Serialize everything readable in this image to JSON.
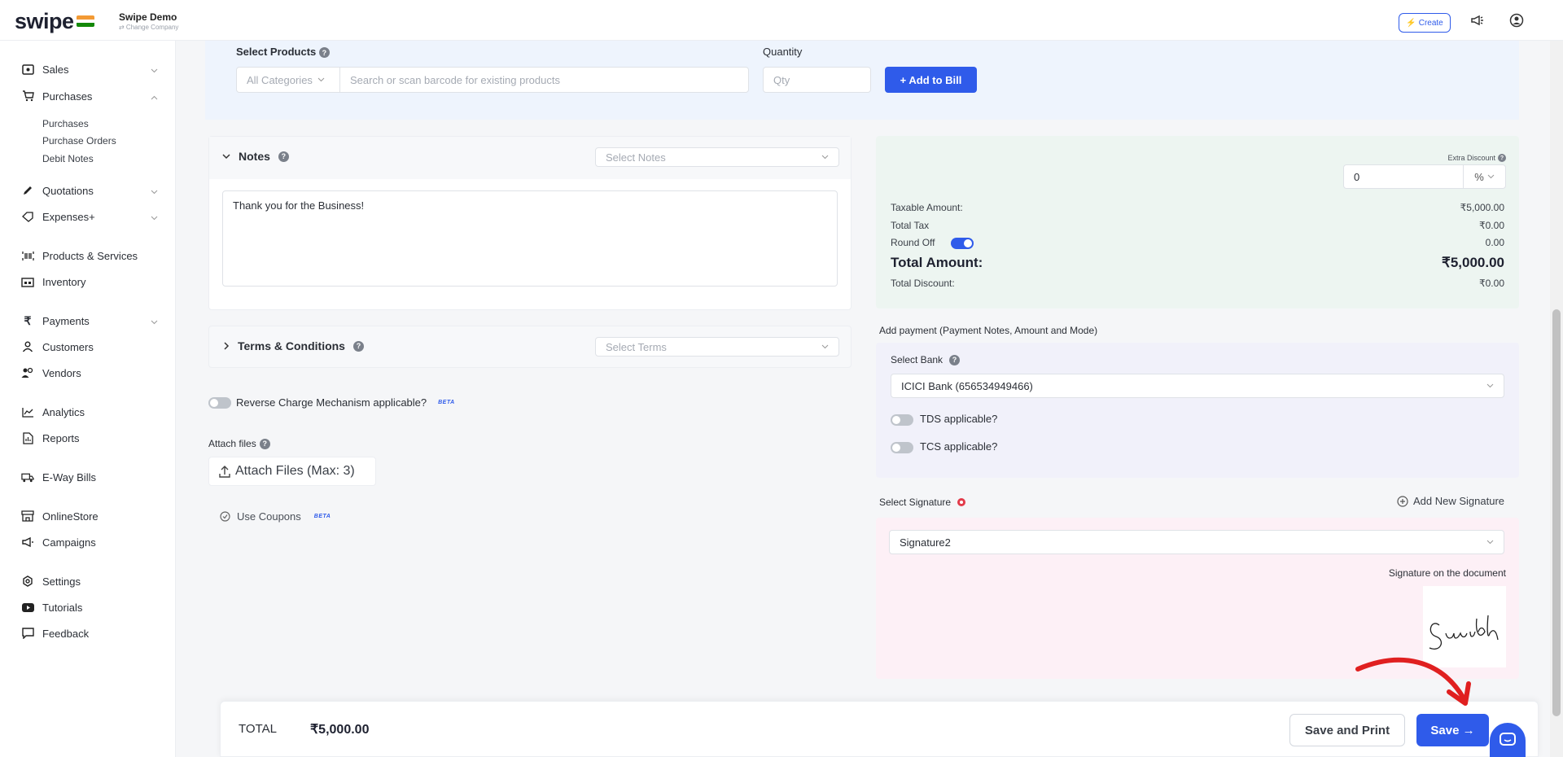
{
  "app": {
    "logo": "swipe",
    "company_name": "Swipe Demo",
    "change_company": "⇄ Change Company",
    "create_label": "Create"
  },
  "colors": {
    "accent": "#2f5bea",
    "danger": "#e23b4a",
    "flag": [
      "#f39a34",
      "#ffffff",
      "#138808"
    ]
  },
  "sidebar": {
    "items": [
      {
        "label": "Sales",
        "icon": "sales-icon"
      },
      {
        "label": "Purchases",
        "icon": "cart-icon"
      },
      {
        "label": "Quotations",
        "icon": "pencil-icon"
      },
      {
        "label": "Expenses+",
        "icon": "tag-icon"
      },
      {
        "label": "Products & Services",
        "icon": "barcode-icon"
      },
      {
        "label": "Inventory",
        "icon": "inventory-icon"
      },
      {
        "label": "Payments",
        "icon": "rupee-icon"
      },
      {
        "label": "Customers",
        "icon": "user-icon"
      },
      {
        "label": "Vendors",
        "icon": "users-icon"
      },
      {
        "label": "Analytics",
        "icon": "chart-icon"
      },
      {
        "label": "Reports",
        "icon": "report-icon"
      },
      {
        "label": "E-Way Bills",
        "icon": "truck-icon"
      },
      {
        "label": "OnlineStore",
        "icon": "store-icon"
      },
      {
        "label": "Campaigns",
        "icon": "megaphone-icon"
      },
      {
        "label": "Settings",
        "icon": "settings-icon"
      },
      {
        "label": "Tutorials",
        "icon": "youtube-icon"
      },
      {
        "label": "Feedback",
        "icon": "feedback-icon"
      }
    ],
    "purchases_sub": [
      "Purchases",
      "Purchase Orders",
      "Debit Notes"
    ]
  },
  "products": {
    "label": "Select Products",
    "category_value": "All Categories",
    "search_placeholder": "Search or scan barcode for existing products",
    "quantity_label": "Quantity",
    "qty_placeholder": "Qty",
    "add_button": "+ Add to Bill"
  },
  "notes": {
    "title": "Notes",
    "select_placeholder": "Select Notes",
    "text": "Thank you for the Business!"
  },
  "terms": {
    "title": "Terms & Conditions",
    "select_placeholder": "Select Terms"
  },
  "reverse_charge": {
    "label": "Reverse Charge Mechanism applicable?",
    "badge": "BETA"
  },
  "attach": {
    "label": "Attach files",
    "button": "Attach Files (Max: 3)"
  },
  "coupons": {
    "label": "Use Coupons",
    "badge": "BETA"
  },
  "summary": {
    "extra_discount_label": "Extra Discount",
    "discount_value": "0",
    "discount_unit": "%",
    "taxable_label": "Taxable Amount:",
    "taxable_value": "₹5,000.00",
    "total_tax_label": "Total Tax",
    "total_tax_value": "₹0.00",
    "round_off_label": "Round Off",
    "round_off_value": "0.00",
    "total_amount_label": "Total Amount:",
    "total_amount_value": "₹5,000.00",
    "total_discount_label": "Total Discount:",
    "total_discount_value": "₹0.00"
  },
  "payment": {
    "title": "Add payment (Payment Notes, Amount and Mode)",
    "bank_label": "Select Bank",
    "bank_value": "ICICI Bank (656534949466)",
    "tds_label": "TDS applicable?",
    "tcs_label": "TCS applicable?"
  },
  "signature": {
    "label": "Select Signature",
    "add_new": "Add New Signature",
    "value": "Signature2",
    "on_document": "Signature on the document",
    "signature_text": "Suvidh"
  },
  "footer": {
    "total_label": "TOTAL",
    "total_value": "₹5,000.00",
    "save_print": "Save and Print",
    "save": "Save →"
  }
}
